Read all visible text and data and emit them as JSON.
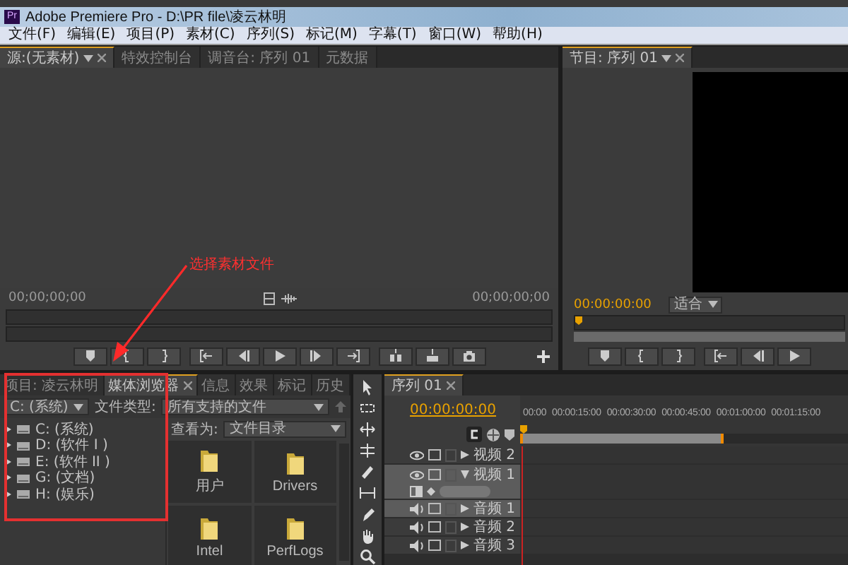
{
  "window": {
    "logo": "Pr",
    "title": "Adobe Premiere Pro - D:\\PR file\\凌云林明"
  },
  "menu": [
    "文件(F)",
    "编辑(E)",
    "项目(P)",
    "素材(C)",
    "序列(S)",
    "标记(M)",
    "字幕(T)",
    "窗口(W)",
    "帮助(H)"
  ],
  "source_monitor": {
    "tabs": [
      {
        "label": "源:(无素材)",
        "selected": true
      },
      {
        "label": "特效控制台",
        "selected": false
      },
      {
        "label": "调音台: 序列 01",
        "selected": false
      },
      {
        "label": "元数据",
        "selected": false
      }
    ],
    "timecode_left": "00;00;00;00",
    "timecode_right": "00;00;00;00"
  },
  "program_monitor": {
    "tab": "节目: 序列 01",
    "timecode": "00:00:00:00",
    "zoom": "适合"
  },
  "project_panel": {
    "tabs": [
      {
        "label": "项目: 凌云林明",
        "selected": false
      },
      {
        "label": "媒体浏览器",
        "selected": true
      },
      {
        "label": "信息",
        "selected": false
      },
      {
        "label": "效果",
        "selected": false
      },
      {
        "label": "标记",
        "selected": false
      },
      {
        "label": "历史",
        "selected": false
      }
    ],
    "drive": "C: (系统)",
    "file_type_label": "文件类型:",
    "file_type": "所有支持的文件",
    "view_as_label": "查看为:",
    "view_as": "文件目录",
    "drives": [
      "C: (系统)",
      "D: (软件 I )",
      "E: (软件 II )",
      "G: (文档)",
      "H: (娱乐)"
    ],
    "folders": [
      "用户",
      "Drivers",
      "Intel",
      "PerfLogs"
    ]
  },
  "timeline": {
    "tab": "序列 01",
    "timecode": "00:00:00:00",
    "ruler": [
      "00:00",
      "00:00:15:00",
      "00:00:30:00",
      "00:00:45:00",
      "00:01:00:00",
      "00:01:15:00"
    ],
    "tracks": [
      {
        "name": "视频 2",
        "kind": "video",
        "expanded": false,
        "selected": false
      },
      {
        "name": "视频 1",
        "kind": "video",
        "expanded": true,
        "selected": true
      },
      {
        "name": "音频 1",
        "kind": "audio",
        "expanded": false,
        "selected": true
      },
      {
        "name": "音频 2",
        "kind": "audio",
        "expanded": false,
        "selected": false
      },
      {
        "name": "音频 3",
        "kind": "audio",
        "expanded": false,
        "selected": false
      }
    ]
  },
  "annotation": {
    "text": "选择素材文件"
  }
}
